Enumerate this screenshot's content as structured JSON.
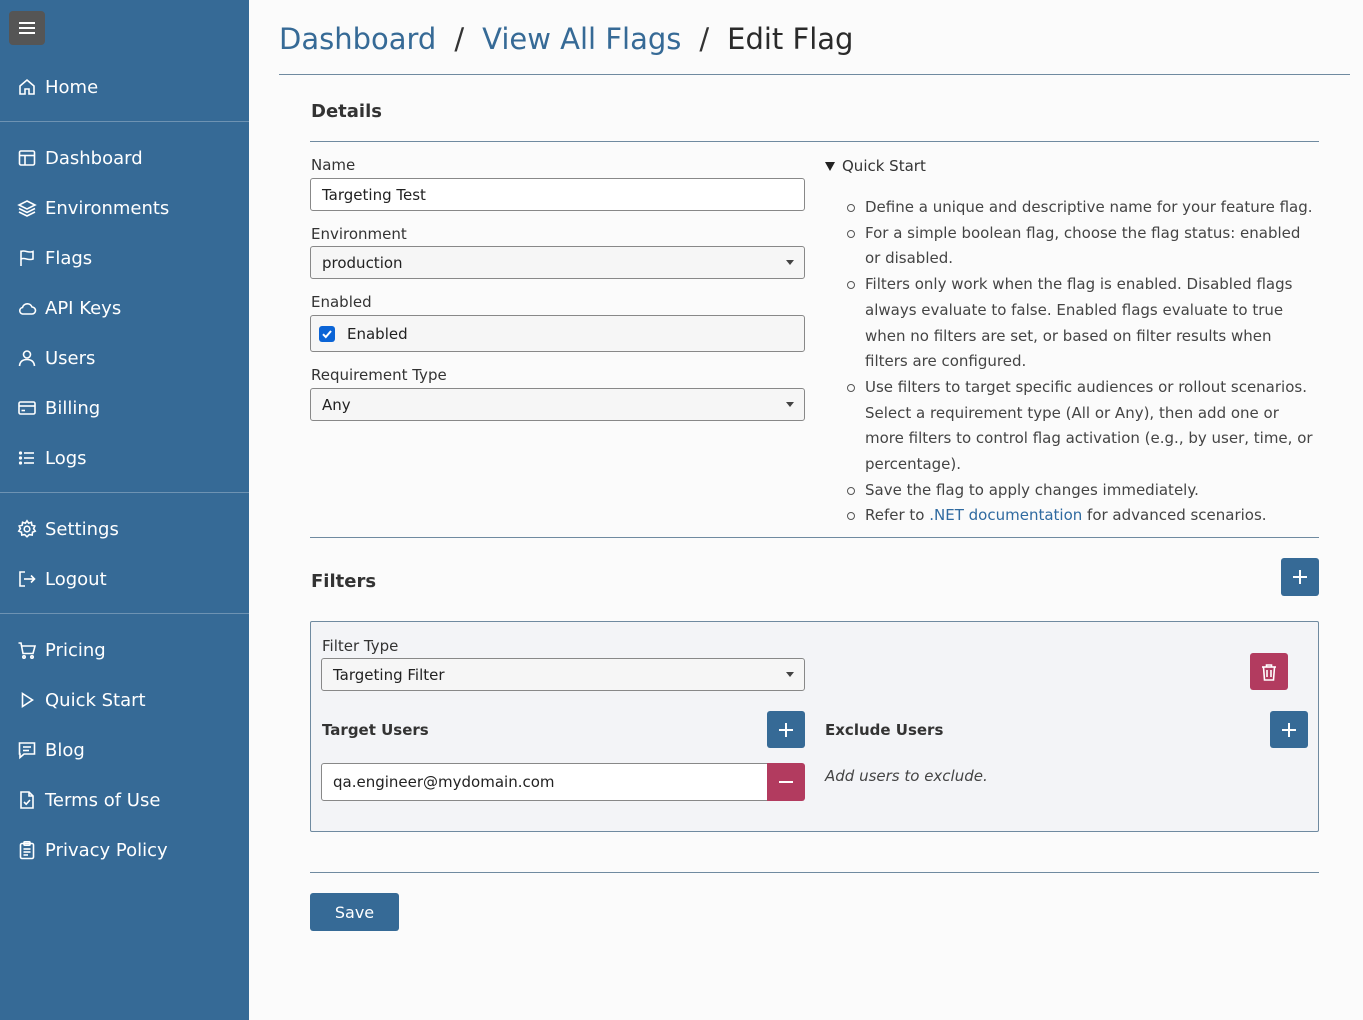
{
  "sidebar": {
    "menu_icon": "hamburger-icon",
    "items": [
      {
        "label": "Home",
        "icon": "home-icon"
      },
      {
        "label": "Dashboard",
        "icon": "dashboard-icon"
      },
      {
        "label": "Environments",
        "icon": "layers-icon"
      },
      {
        "label": "Flags",
        "icon": "flag-icon"
      },
      {
        "label": "API Keys",
        "icon": "cloud-icon"
      },
      {
        "label": "Users",
        "icon": "user-icon"
      },
      {
        "label": "Billing",
        "icon": "credit-card-icon"
      },
      {
        "label": "Logs",
        "icon": "list-icon"
      },
      {
        "label": "Settings",
        "icon": "gear-icon"
      },
      {
        "label": "Logout",
        "icon": "logout-icon"
      },
      {
        "label": "Pricing",
        "icon": "cart-icon"
      },
      {
        "label": "Quick Start",
        "icon": "play-icon"
      },
      {
        "label": "Blog",
        "icon": "chat-icon"
      },
      {
        "label": "Terms of Use",
        "icon": "document-check-icon"
      },
      {
        "label": "Privacy Policy",
        "icon": "clipboard-icon"
      }
    ]
  },
  "breadcrumb": {
    "items": [
      "Dashboard",
      "View All Flags",
      "Edit Flag"
    ],
    "separator": "/"
  },
  "details": {
    "title": "Details",
    "name_label": "Name",
    "name_value": "Targeting Test",
    "environment_label": "Environment",
    "environment_value": "production",
    "enabled_label": "Enabled",
    "enabled_checkbox_label": "Enabled",
    "enabled_checked": true,
    "requirement_label": "Requirement Type",
    "requirement_value": "Any"
  },
  "quick_start": {
    "summary": "Quick Start",
    "items": [
      "Define a unique and descriptive name for your feature flag.",
      "For a simple boolean flag, choose the flag status: enabled or disabled.",
      "Filters only work when the flag is enabled. Disabled flags always evaluate to false. Enabled flags evaluate to true when no filters are set, or based on filter results when filters are configured.",
      "Use filters to target specific audiences or rollout scenarios. Select a requirement type (All or Any), then add one or more filters to control flag activation (e.g., by user, time, or percentage).",
      "Save the flag to apply changes immediately."
    ],
    "last_prefix": "Refer to ",
    "last_link": ".NET documentation",
    "last_suffix": " for advanced scenarios."
  },
  "filters": {
    "title": "Filters",
    "filter_type_label": "Filter Type",
    "filter_type_value": "Targeting Filter",
    "target_users_label": "Target Users",
    "target_users": [
      "qa.engineer@mydomain.com"
    ],
    "exclude_users_label": "Exclude Users",
    "exclude_placeholder": "Add users to exclude."
  },
  "save_label": "Save",
  "colors": {
    "sidebar": "#366a96",
    "primary": "#366a96",
    "danger": "#b23b5f",
    "link": "#2f6aa0"
  }
}
